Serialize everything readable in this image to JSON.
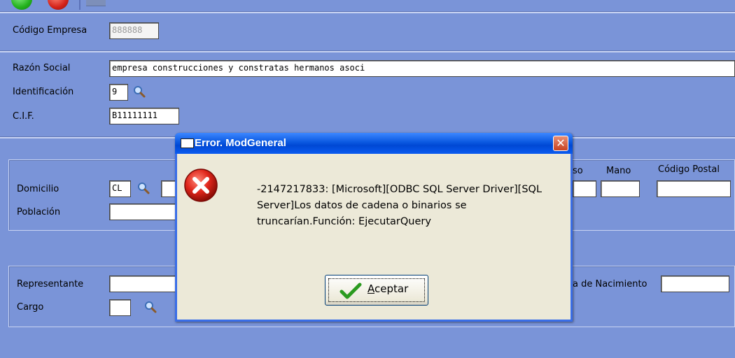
{
  "empresa": {
    "codigo_label": "Código Empresa",
    "codigo_value": "888888"
  },
  "datos": {
    "razon_label": "Razón Social",
    "razon_value": "empresa construcciones y constratas hermanos asoci",
    "ident_label": "Identificación",
    "ident_value": "9",
    "cif_label": "C.I.F.",
    "cif_value": "B11111111"
  },
  "domicilio": {
    "domicilio_label": "Domicilio",
    "via_value": "CL",
    "poblacion_label": "Población",
    "piso_partial": "so",
    "mano_label": "Mano",
    "cp_label": "Código Postal"
  },
  "representante": {
    "representante_label": "Representante",
    "cargo_label": "Cargo",
    "nacimiento_partial": "a de Nacimiento"
  },
  "dialog": {
    "title": "Error. ModGeneral",
    "close_glyph": "✕",
    "message": "-2147217833: [Microsoft][ODBC SQL Server Driver][SQL Server]Los datos de cadena o binarios se truncarían.Función: EjecutarQuery",
    "button_accel": "A",
    "button_rest": "ceptar"
  },
  "icons": {
    "error": "error-icon",
    "search": "magnifier-icon",
    "ok": "checkmark-icon"
  },
  "colors": {
    "form_background": "#7a94d8",
    "titlebar": "#0a58e0",
    "dialog_face": "#ece9d8",
    "error_red": "#d4231a"
  }
}
